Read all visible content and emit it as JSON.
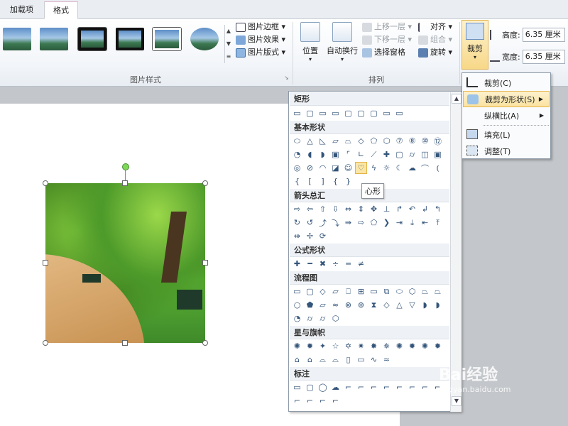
{
  "tabs": [
    {
      "label": "加载项",
      "active": false
    },
    {
      "label": "格式",
      "active": true
    }
  ],
  "ribbon": {
    "picture_styles": {
      "group_label": "图片样式",
      "commands": [
        "图片边框",
        "图片效果",
        "图片版式"
      ]
    },
    "arrange": {
      "group_label": "排列",
      "position_label": "位置",
      "wrap_label": "自动换行",
      "commands": [
        {
          "label": "上移一层",
          "enabled": false
        },
        {
          "label": "下移一层",
          "enabled": false
        },
        {
          "label": "选择窗格",
          "enabled": true
        },
        {
          "label": "对齐",
          "enabled": true
        },
        {
          "label": "组合",
          "enabled": false
        },
        {
          "label": "旋转",
          "enabled": true
        }
      ]
    },
    "size": {
      "crop_label": "裁剪",
      "height_label": "高度:",
      "height_value": "6.35 厘米",
      "width_label": "宽度:",
      "width_value": "6.35 厘米"
    }
  },
  "crop_menu": {
    "items": [
      {
        "label": "裁剪(C)",
        "has_submenu": false,
        "highlighted": false
      },
      {
        "label": "裁剪为形状(S)",
        "has_submenu": true,
        "highlighted": true
      },
      {
        "label": "纵横比(A)",
        "has_submenu": true,
        "highlighted": false
      },
      {
        "label": "填充(L)",
        "has_submenu": false,
        "highlighted": false
      },
      {
        "label": "调整(T)",
        "has_submenu": false,
        "highlighted": false
      }
    ]
  },
  "gallery": {
    "sections": [
      "矩形",
      "基本形状",
      "箭头总汇",
      "公式形状",
      "流程图",
      "星与旗帜",
      "标注"
    ],
    "tooltip": "心形"
  },
  "watermark": {
    "text": "Bai经验",
    "sub": "jingyan.baidu.com"
  },
  "colors": {
    "accent": "#e0b1cc",
    "highlight": "#fbe6a5",
    "ribbon_bg": "#f2f5f9"
  }
}
